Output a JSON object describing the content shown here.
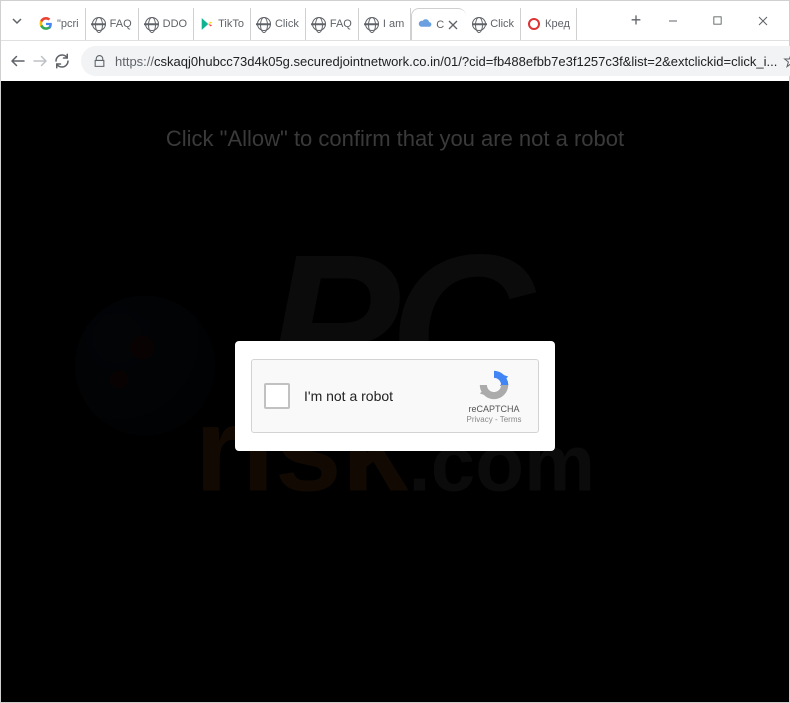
{
  "tabs": [
    {
      "title": "\"pcri",
      "favicon": "google"
    },
    {
      "title": "FAQ",
      "favicon": "globe"
    },
    {
      "title": "DDO",
      "favicon": "globe"
    },
    {
      "title": "TikTo",
      "favicon": "play"
    },
    {
      "title": "Click",
      "favicon": "globe"
    },
    {
      "title": "FAQ",
      "favicon": "globe"
    },
    {
      "title": "I am",
      "favicon": "globe"
    },
    {
      "title": "C",
      "favicon": "cloud",
      "active": true
    },
    {
      "title": "Click",
      "favicon": "globe"
    },
    {
      "title": "Кред",
      "favicon": "red"
    }
  ],
  "url": {
    "protocol": "https://",
    "rest": "cskaqj0hubcc73d4k05g.securedjointnetwork.co.in/01/?cid=fb488efbb7e3f1257c3f&list=2&extclickid=click_i..."
  },
  "page": {
    "instruction": "Click \"Allow\" to confirm that you are not a robot"
  },
  "captcha": {
    "label": "I'm not a robot",
    "brand": "reCAPTCHA",
    "links": "Privacy - Terms"
  },
  "watermark": {
    "top": "PC",
    "bottom_main": "risk",
    "bottom_suffix": ".com"
  }
}
